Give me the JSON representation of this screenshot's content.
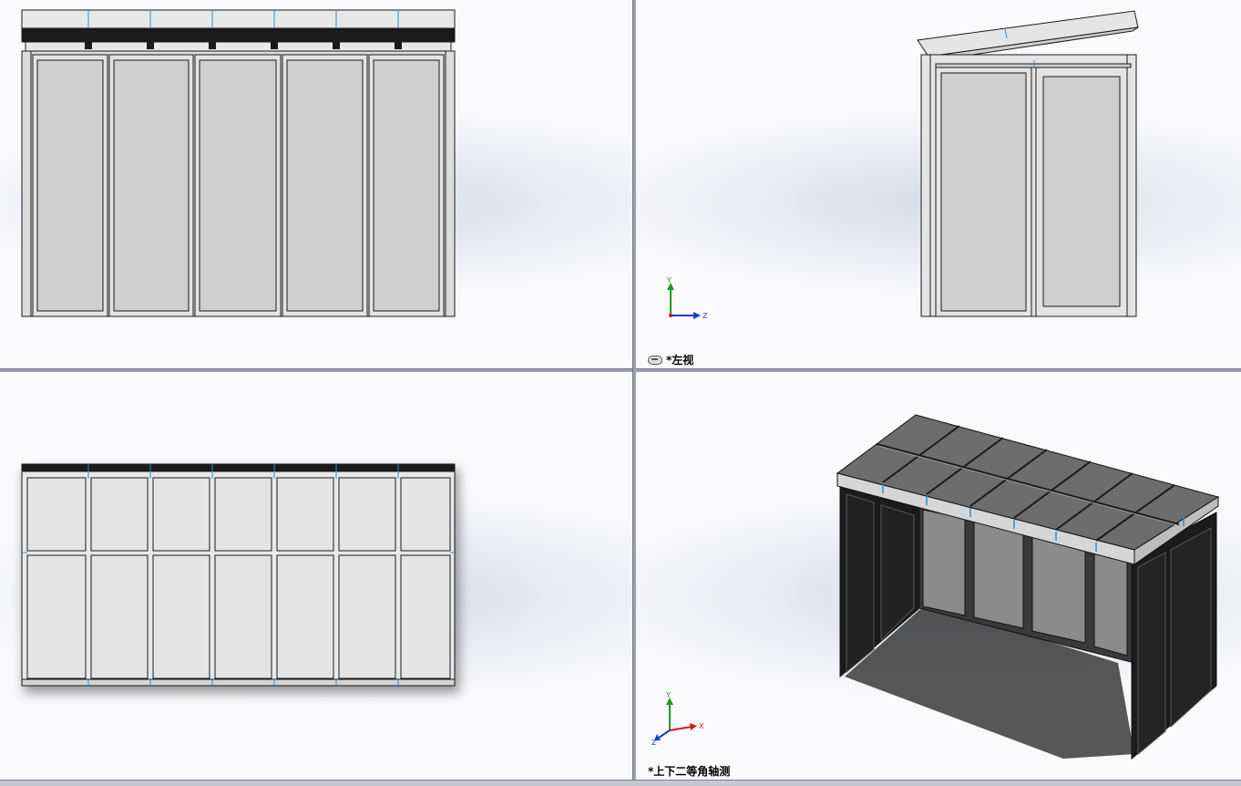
{
  "app": "SolidWorks",
  "viewports": {
    "top_left": {
      "name": "front-view",
      "label": ""
    },
    "top_right": {
      "name": "left-view",
      "label": "*左视"
    },
    "bottom_left": {
      "name": "top-view",
      "label": ""
    },
    "bottom_right": {
      "name": "dimetric-view",
      "label": "*上下二等角轴测"
    }
  },
  "triad": {
    "y": "Y",
    "z": "Z",
    "x": "X"
  },
  "colors": {
    "panel_fill": "#cfcfcf",
    "frame_fill": "#e4e4e4",
    "edge": "#1a1a1a",
    "centerline": "#2d8fd0",
    "dark_body": "#1b1b1b",
    "roof_panel": "#6d6d6d",
    "axis_y": "#1a9a1a",
    "axis_z": "#1a3bd0",
    "axis_x": "#d01a1a"
  },
  "icons": [
    "link-icon"
  ]
}
